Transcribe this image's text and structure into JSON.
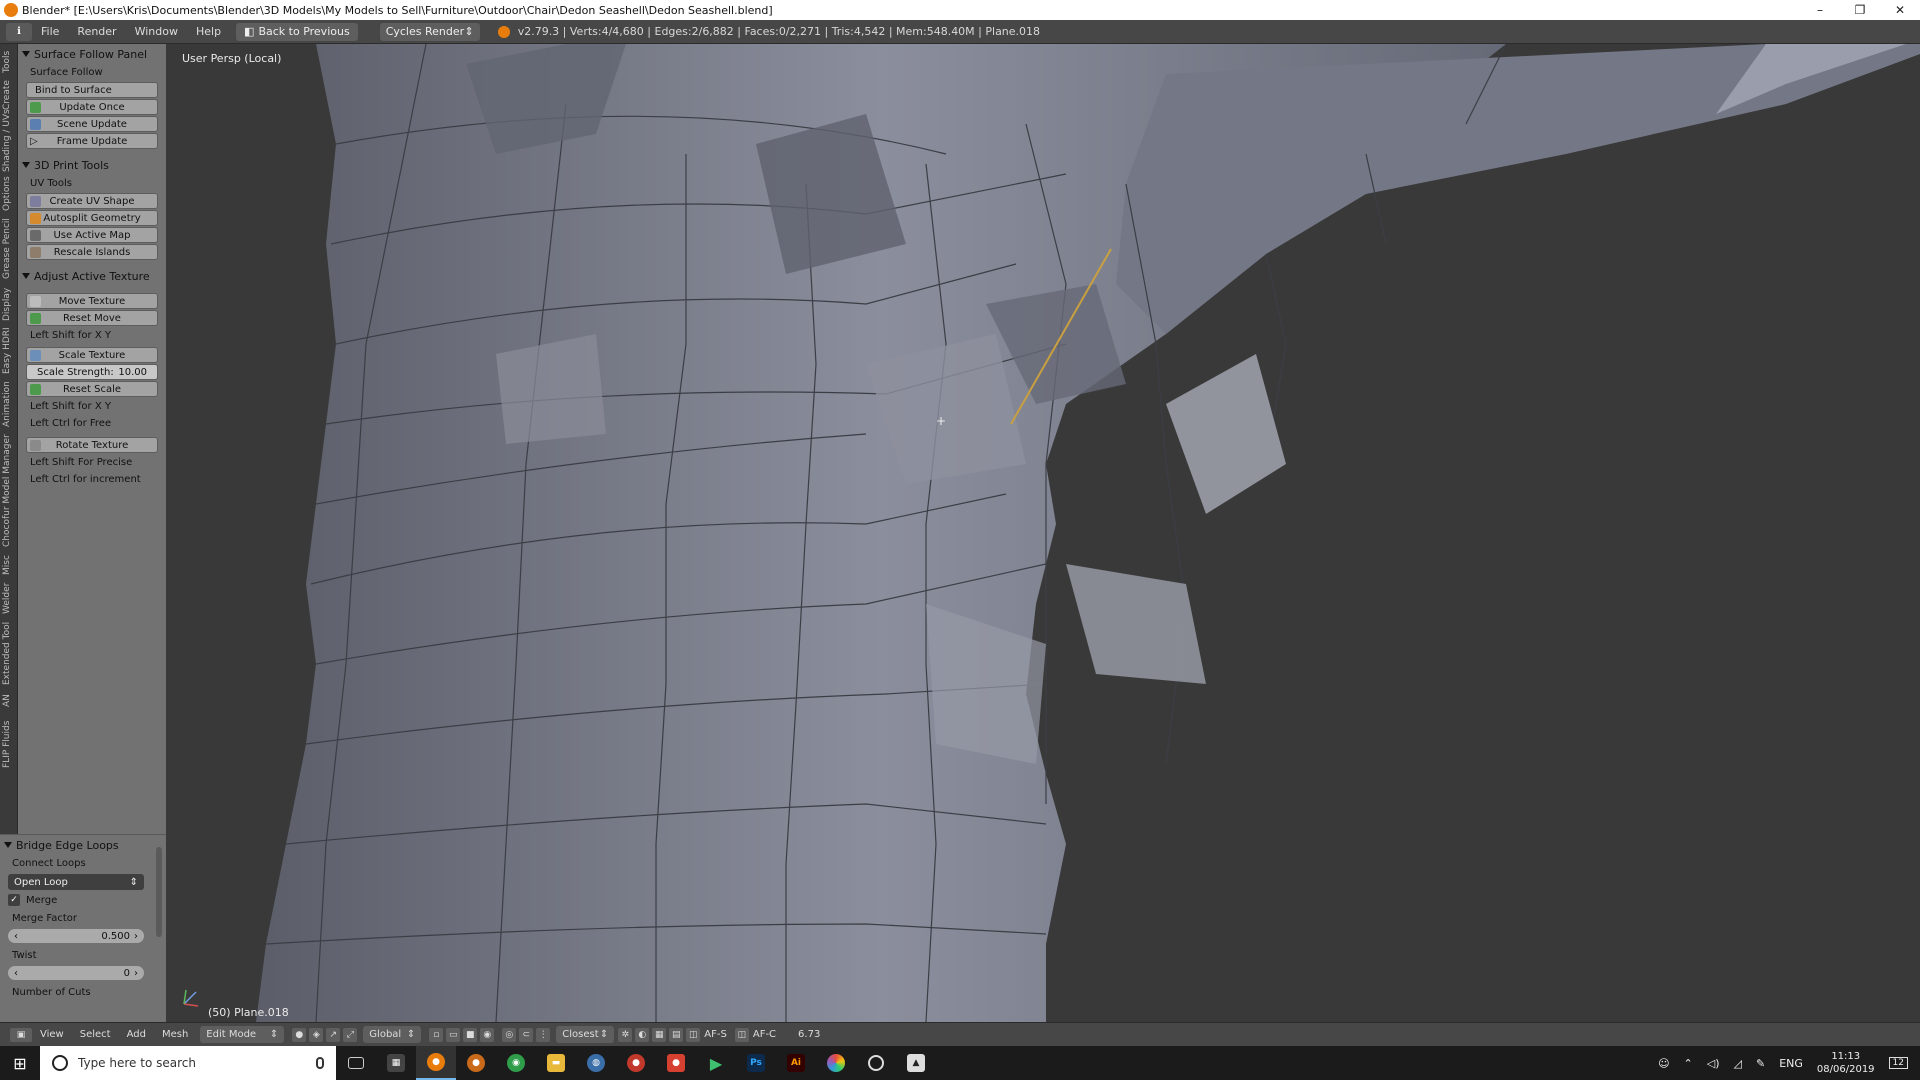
{
  "window": {
    "title": "Blender* [E:\\Users\\Kris\\Documents\\Blender\\3D Models\\My Models to Sell\\Furniture\\Outdoor\\Chair\\Dedon Seashell\\Dedon Seashell.blend]",
    "minimize": "–",
    "restore": "❐",
    "close": "✕"
  },
  "topbar": {
    "menus": [
      "File",
      "Render",
      "Window",
      "Help"
    ],
    "back_label": "Back to Previous",
    "engine": "Cycles Render",
    "stats": "v2.79.3 | Verts:4/4,680 | Edges:2/6,882 | Faces:0/2,271 | Tris:4,542 | Mem:548.40M | Plane.018"
  },
  "tabs": [
    "Tools",
    "Create",
    "Shading / UVs",
    "Options",
    "Grease Pencil",
    "Display",
    "Easy HDRI",
    "Animation",
    "Chocofur Model Manager",
    "Misc",
    "Welder",
    "Extended Tool",
    "AN",
    "FLIP Fluids"
  ],
  "surface_follow": {
    "header": "Surface Follow Panel",
    "section_label": "Surface Follow",
    "bind_label": "Bind to Surface",
    "buttons": [
      "Update Once",
      "Scene Update",
      "Frame Update"
    ]
  },
  "print3d": {
    "header": "3D Print Tools",
    "section_label": "UV Tools",
    "buttons": [
      "Create UV Shape",
      "Autosplit Geometry",
      "Use Active Map",
      "Rescale Islands"
    ]
  },
  "adjust_texture": {
    "header": "Adjust Active Texture",
    "move_button": "Move Texture",
    "reset_move": "Reset Move",
    "hint_move": "Left Shift for X Y",
    "scale_button": "Scale Texture",
    "scale_strength_label": "Scale Strength:",
    "scale_strength_value": "10.00",
    "reset_scale": "Reset Scale",
    "hint_scale_1": "Left Shift for X Y",
    "hint_scale_2": "Left Ctrl for Free",
    "rotate_button": "Rotate Texture",
    "hint_rotate_1": "Left Shift For Precise",
    "hint_rotate_2": "Left Ctrl for increment"
  },
  "bridge": {
    "header": "Bridge Edge Loops",
    "connect_label": "Connect Loops",
    "connect_value": "Open Loop",
    "merge_label": "Merge",
    "merge_factor_label": "Merge Factor",
    "merge_factor_value": "0.500",
    "twist_label": "Twist",
    "twist_value": "0",
    "cuts_label": "Number of Cuts"
  },
  "viewport": {
    "view_label": "User Persp (Local)",
    "object_label": "(50) Plane.018",
    "cursor": "+"
  },
  "bottom_header": {
    "menus": [
      "View",
      "Select",
      "Add",
      "Mesh"
    ],
    "mode": "Edit Mode",
    "orientation": "Global",
    "snap": "Closest",
    "afs": "AF-S",
    "afc": "AF-C",
    "value": "6.73"
  },
  "taskbar": {
    "search_placeholder": "Type here to search",
    "language": "ENG",
    "time": "11:13",
    "date": "08/06/2019",
    "notifications": "12"
  },
  "colors": {
    "panel_bg": "#727272",
    "button_bg": "#a3a3a3",
    "viewport_bg": "#393939",
    "header_bg": "#474747",
    "blender_orange": "#e87d0d",
    "mesh_face": "#7a7d8a",
    "taskbar_bg": "#1b1b1b"
  }
}
